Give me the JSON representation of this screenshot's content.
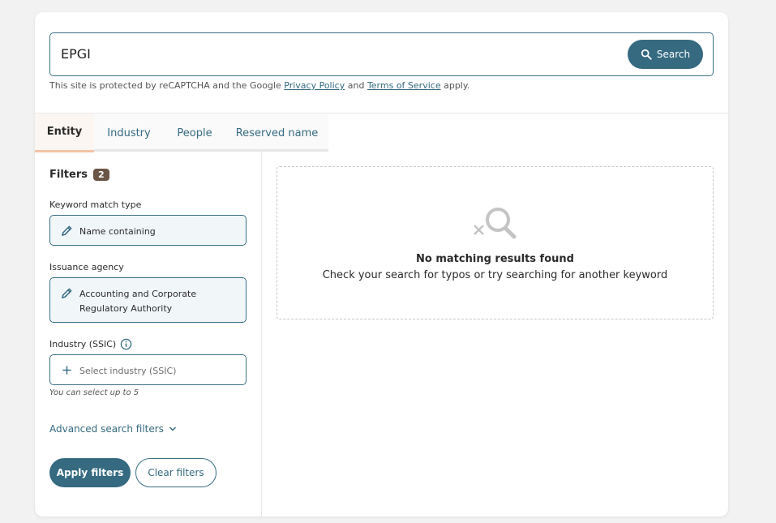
{
  "search": {
    "value": "EPGI",
    "button_label": "Search",
    "captcha_prefix": "This site is protected by reCAPTCHA and the Google ",
    "privacy_link": "Privacy Policy",
    "and_text": " and ",
    "terms_link": "Terms of Service",
    "captcha_suffix": " apply."
  },
  "tabs": [
    {
      "label": "Entity",
      "active": true
    },
    {
      "label": "Industry",
      "active": false
    },
    {
      "label": "People",
      "active": false
    },
    {
      "label": "Reserved name",
      "active": false
    }
  ],
  "filters": {
    "title": "Filters",
    "count": "2",
    "keyword_label": "Keyword match type",
    "keyword_value": "Name containing",
    "agency_label": "Issuance agency",
    "agency_value": "Accounting and Corporate Regulatory Authority",
    "industry_label": "Industry (SSIC)",
    "industry_placeholder": "Select industry (SSIC)",
    "industry_hint": "You can select up to 5",
    "advanced_label": "Advanced search filters",
    "apply_label": "Apply filters",
    "clear_label": "Clear filters"
  },
  "results": {
    "empty_title": "No matching results found",
    "empty_subtitle": "Check your search for typos or try searching for another keyword"
  },
  "icons": {
    "search": "search-icon",
    "edit": "pencil-icon",
    "add": "plus-icon",
    "info": "info-icon",
    "chevron": "chevron-down-icon",
    "no_results": "search-x-icon"
  },
  "colors": {
    "primary": "#356a80",
    "badge": "#6b5546",
    "active_tab_underline": "#f2c3a5"
  }
}
